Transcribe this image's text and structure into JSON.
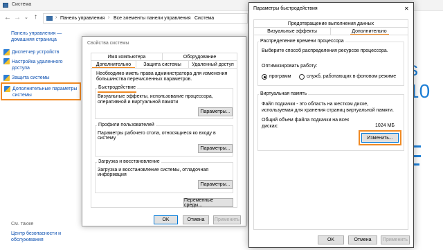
{
  "control_panel": {
    "title": "Система",
    "breadcrumb": {
      "item1": "Панель управления",
      "item2": "Все элементы панели управления",
      "item3": "Система"
    },
    "sidebar": {
      "home_line1": "Панель управления —",
      "home_line2": "домашняя страница",
      "items": [
        {
          "label": "Диспетчер устройств"
        },
        {
          "label": "Настройка удаленного доступа"
        },
        {
          "label": "Защита системы"
        },
        {
          "label": "Дополнительные параметры системы"
        }
      ],
      "see_also": "См. также",
      "security_center_line1": "Центр безопасности и",
      "security_center_line2": "обслуживания"
    },
    "big_text": "s 10"
  },
  "system_properties": {
    "title": "Свойства системы",
    "tabs_row1": [
      "Имя компьютера",
      "Оборудование"
    ],
    "tabs_row2": [
      "Дополнительно",
      "Защита системы",
      "Удаленный доступ"
    ],
    "admin_note": "Необходимо иметь права администратора для изменения большинства перечисленных параметров.",
    "performance": {
      "title": "Быстродействие",
      "desc": "Визуальные эффекты, использование процессора, оперативной и виртуальной памяти",
      "button": "Параметры..."
    },
    "profiles": {
      "title": "Профили пользователей",
      "desc": "Параметры рабочего стола, относящиеся ко входу в систему",
      "button": "Параметры..."
    },
    "startup": {
      "title": "Загрузка и восстановление",
      "desc": "Загрузка и восстановление системы, отладочная информация",
      "button": "Параметры..."
    },
    "env_button": "Переменные среды...",
    "ok": "OK",
    "cancel": "Отмена",
    "apply": "Применить"
  },
  "performance_options": {
    "title": "Параметры быстродействия",
    "close_glyph": "✕",
    "tabs_row1": [
      "Предотвращение выполнения данных"
    ],
    "tabs_row2": [
      "Визуальные эффекты",
      "Дополнительно"
    ],
    "cpu": {
      "title": "Распределение времени процессора",
      "desc": "Выберите способ распределения ресурсов процессора.",
      "optimize_label": "Оптимизировать работу:",
      "option_programs": "программ",
      "option_services": "служб, работающих в фоновом режиме",
      "selected": "programs"
    },
    "vm": {
      "title": "Виртуальная память",
      "desc": "Файл подкачки - это область на жестком диске, используемая для хранения страниц виртуальной памяти.",
      "total_label": "Общий объем файла подкачки на всех дисках:",
      "total_value": "1024 МБ",
      "change_button": "Изменить..."
    },
    "ok": "OK",
    "cancel": "Отмена",
    "apply": "Применить"
  },
  "colors": {
    "accent_orange": "#f08a24",
    "dark_titlebar": "#1f1f1f",
    "link_blue": "#0b4fb0"
  }
}
